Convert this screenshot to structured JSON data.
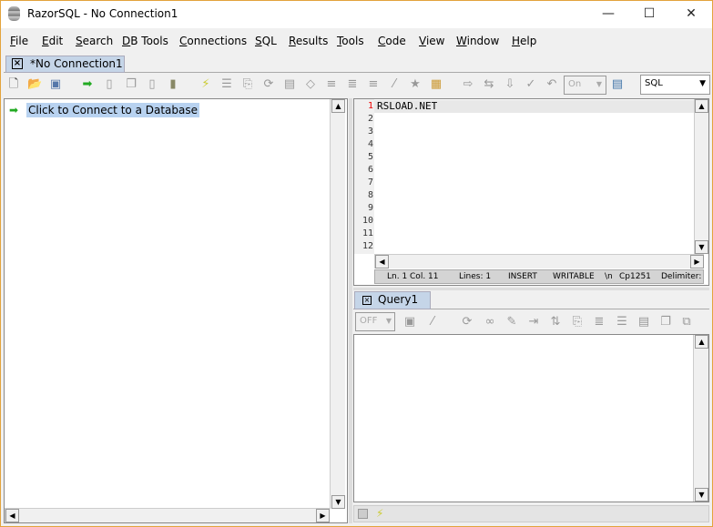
{
  "window": {
    "title": "RazorSQL - No Connection1",
    "minimize": "—",
    "maximize": "☐",
    "close": "✕"
  },
  "menu": [
    "File",
    "Edit",
    "Search",
    "DB Tools",
    "Connections",
    "SQL",
    "Results",
    "Tools",
    "Code",
    "View",
    "Window",
    "Help"
  ],
  "connection_tab": "*No Connection1",
  "toolbar": {
    "autocommit_value": "On",
    "language_value": "SQL"
  },
  "tree": {
    "connect_item": "Click to Connect to a Database"
  },
  "editor": {
    "lines": [
      "1",
      "2",
      "3",
      "4",
      "5",
      "6",
      "7",
      "8",
      "9",
      "10",
      "11",
      "12"
    ],
    "content": "RSLOAD.NET"
  },
  "status": {
    "position": "Ln. 1 Col. 11",
    "lines": "Lines: 1",
    "mode": "INSERT",
    "access": "WRITABLE",
    "newline": "\\n",
    "encoding": "Cp1251",
    "delimiter": "Delimiter:"
  },
  "query_tab": "Query1",
  "results_toolbar": {
    "paging_value": "OFF"
  }
}
